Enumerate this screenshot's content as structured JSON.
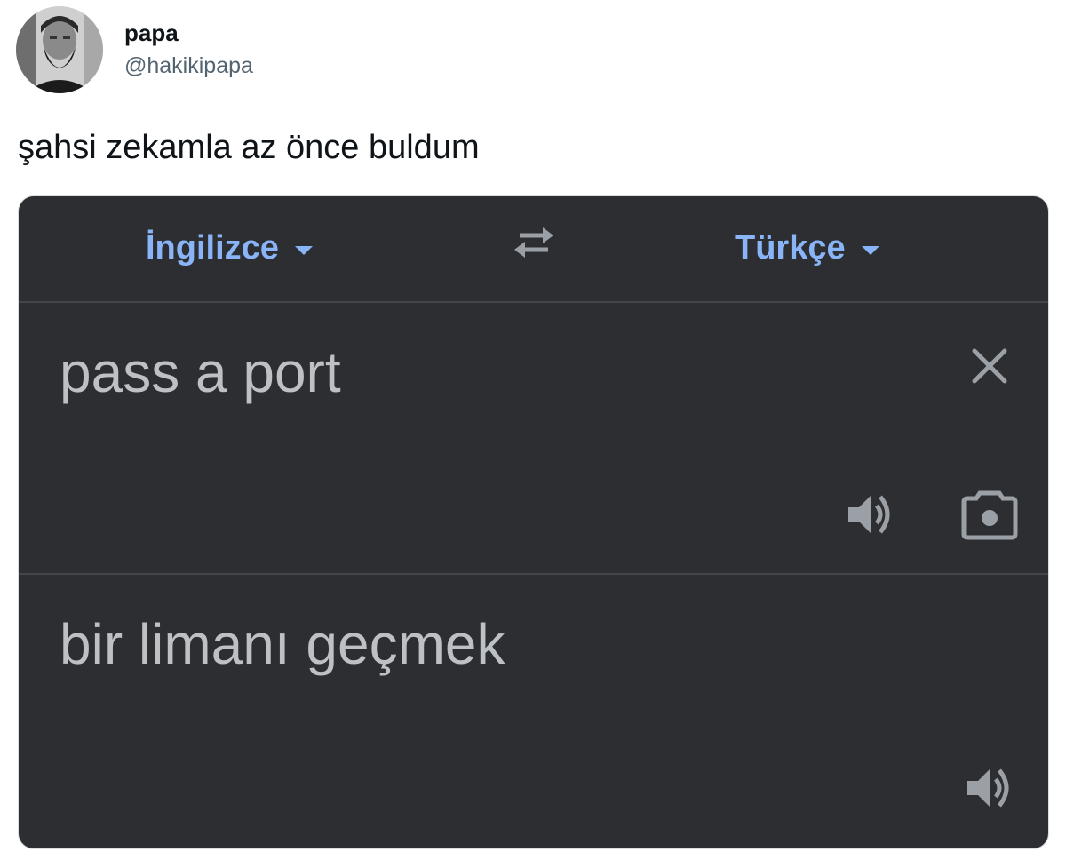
{
  "tweet": {
    "display_name": "papa",
    "handle": "@hakikipapa",
    "text": "şahsi zekamla az önce buldum",
    "avatar_icon": "profile-photo"
  },
  "translator": {
    "source_language": "İngilizce",
    "target_language": "Türkçe",
    "source_text": "pass a port",
    "translated_text": "bir limanı geçmek",
    "icons": {
      "swap": "swap-arrows-icon",
      "clear": "close-icon",
      "listen": "speaker-icon",
      "camera": "camera-icon",
      "dropdown": "caret-down-icon"
    },
    "colors": {
      "background": "#2d2e31",
      "accent": "#8ab4f8",
      "text": "#bdc1c6",
      "icon": "#9aa0a6",
      "divider": "#43454a"
    }
  }
}
